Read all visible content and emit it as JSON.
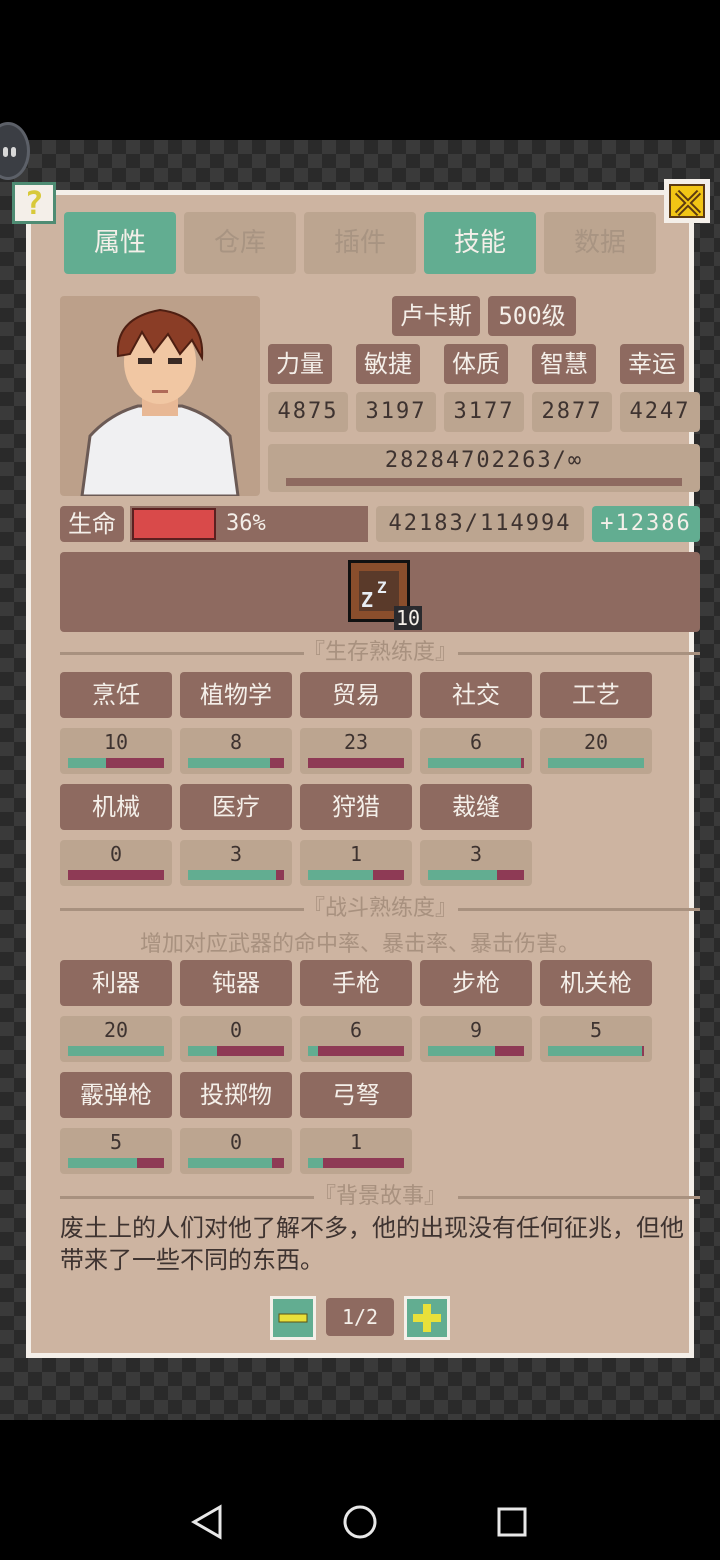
{
  "tabs": [
    {
      "label": "属性",
      "active": true
    },
    {
      "label": "仓库",
      "active": false
    },
    {
      "label": "插件",
      "active": false
    },
    {
      "label": "技能",
      "active": true
    },
    {
      "label": "数据",
      "active": false
    }
  ],
  "character": {
    "name": "卢卡斯",
    "level": "500级",
    "attributes": [
      {
        "label": "力量",
        "value": "4875"
      },
      {
        "label": "敏捷",
        "value": "3197"
      },
      {
        "label": "体质",
        "value": "3177"
      },
      {
        "label": "智慧",
        "value": "2877"
      },
      {
        "label": "幸运",
        "value": "4247"
      }
    ],
    "experience": "28284702263/∞",
    "hp_label": "生命",
    "hp_percent_text": "36%",
    "hp_fraction": 0.36,
    "hp_value": "42183/114994",
    "hp_regen": "+12386",
    "buff_count": "10"
  },
  "survival": {
    "title": "『生存熟练度』",
    "skills": [
      {
        "label": "烹饪",
        "value": "10",
        "progress": 0.4
      },
      {
        "label": "植物学",
        "value": "8",
        "progress": 0.85
      },
      {
        "label": "贸易",
        "value": "23",
        "progress": 0.0
      },
      {
        "label": "社交",
        "value": "6",
        "progress": 0.97
      },
      {
        "label": "工艺",
        "value": "20",
        "progress": 1.0
      },
      {
        "label": "机械",
        "value": "0",
        "progress": 0.0
      },
      {
        "label": "医疗",
        "value": "3",
        "progress": 0.92
      },
      {
        "label": "狩猎",
        "value": "1",
        "progress": 0.68
      },
      {
        "label": "裁缝",
        "value": "3",
        "progress": 0.72
      }
    ]
  },
  "combat": {
    "title": "『战斗熟练度』",
    "description": "增加对应武器的命中率、暴击率、暴击伤害。",
    "skills": [
      {
        "label": "利器",
        "value": "20",
        "progress": 1.0
      },
      {
        "label": "钝器",
        "value": "0",
        "progress": 0.3
      },
      {
        "label": "手枪",
        "value": "6",
        "progress": 0.1
      },
      {
        "label": "步枪",
        "value": "9",
        "progress": 0.7
      },
      {
        "label": "机关枪",
        "value": "5",
        "progress": 0.98
      },
      {
        "label": "霰弹枪",
        "value": "5",
        "progress": 0.72
      },
      {
        "label": "投掷物",
        "value": "0",
        "progress": 0.88
      },
      {
        "label": "弓弩",
        "value": "1",
        "progress": 0.16
      }
    ]
  },
  "story": {
    "title": "『背景故事』",
    "text": "废土上的人们对他了解不多，他的出现没有任何征兆，但他带来了一些不同的东西。"
  },
  "pager": {
    "label": "1/2"
  },
  "help": {
    "label": "?"
  },
  "colors": {
    "panel": "#cdb4a1",
    "chip": "#8e6a60",
    "accent": "#62ad91",
    "hp": "#d94a4a",
    "bar_empty": "#8e3a55"
  }
}
